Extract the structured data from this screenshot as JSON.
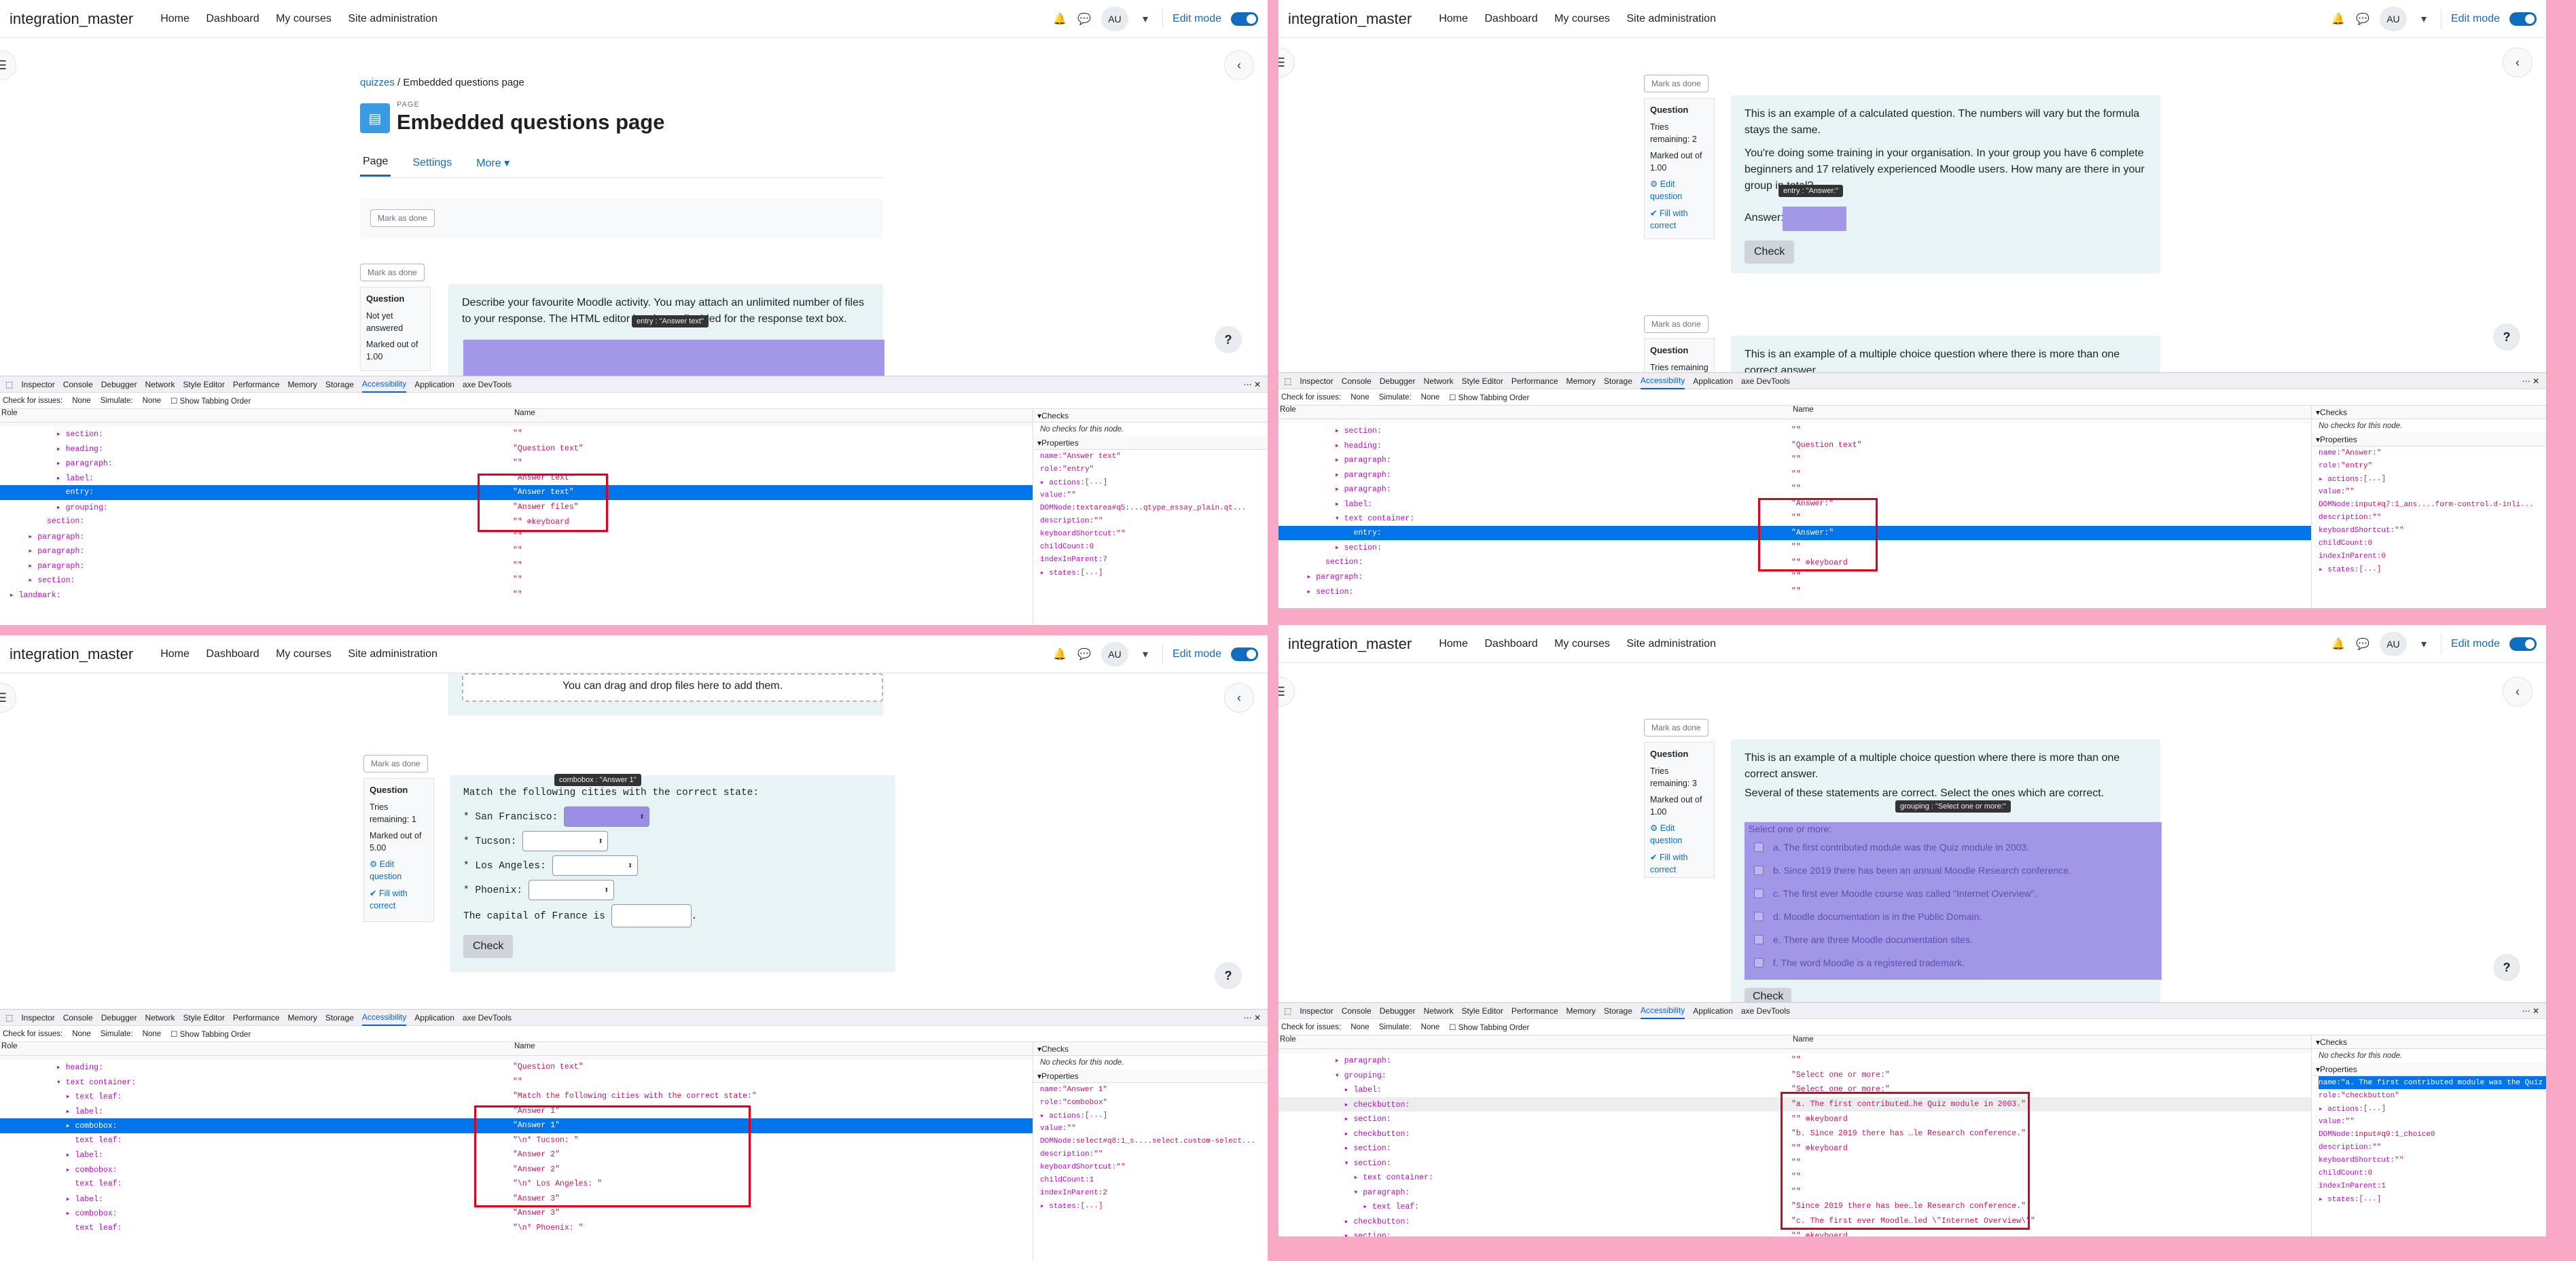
{
  "brand": "integration_master",
  "nav": [
    "Home",
    "Dashboard",
    "My courses",
    "Site administration"
  ],
  "avatar": "AU",
  "edit_mode": "Edit mode",
  "devtools": {
    "tabs": [
      "Inspector",
      "Console",
      "Debugger",
      "Network",
      "Style Editor",
      "Performance",
      "Memory",
      "Storage",
      "Accessibility",
      "Application",
      "axe DevTools"
    ],
    "check_issues": "Check for issues:",
    "check_none": "None",
    "simulate": "Simulate:",
    "simulate_none": "None",
    "tabbing": "Show Tabbing Order",
    "col_role": "Role",
    "col_name": "Name",
    "checks": "Checks",
    "no_checks": "No checks for this node.",
    "properties": "Properties"
  },
  "q0": {
    "crumb_link": "quizzes",
    "crumb_sep": "/",
    "crumb_page": "Embedded questions page",
    "page_label": "PAGE",
    "title": "Embedded questions page",
    "tabs": [
      "Page",
      "Settings",
      "More"
    ],
    "mark_done": "Mark as done",
    "info_title": "Question",
    "info_status": "Not yet answered",
    "info_marked": "Marked out of 1.00",
    "question": "Describe your favourite Moodle activity. You may attach an unlimited number of files to your response. The HTML editor has been disabled for the response text box.",
    "tooltip": "entry : \"Answer text\"",
    "tree": [
      {
        "r": "            ▸ section:",
        "n": "\"\""
      },
      {
        "r": "            ▸ heading:",
        "n": "\"Question text\""
      },
      {
        "r": "            ▸ paragraph:",
        "n": "\"\""
      },
      {
        "r": "            ▸ label:",
        "n": "\"Answer text\""
      },
      {
        "r": "              entry:",
        "n": "\"Answer text\"",
        "sel": true
      },
      {
        "r": "            ▸ grouping:",
        "n": "\"Answer files\""
      },
      {
        "r": "          section:",
        "n": "\"\" ⊕keyboard"
      },
      {
        "r": "      ▸ paragraph:",
        "n": "\"\""
      },
      {
        "r": "      ▸ paragraph:",
        "n": "\"\""
      },
      {
        "r": "      ▸ paragraph:",
        "n": "\"\""
      },
      {
        "r": "      ▸ section:",
        "n": "\"\""
      },
      {
        "r": "  ▸ landmark:",
        "n": "\"\""
      }
    ],
    "props": [
      {
        "k": "name: ",
        "v": "\"Answer text\""
      },
      {
        "k": "role: ",
        "v": "\"entry\""
      },
      {
        "k": "▸ actions: ",
        "v": "[...]"
      },
      {
        "k": "value: ",
        "v": "\"\""
      },
      {
        "k": "DOMNode: ",
        "v": "textarea#q5:...qtype_essay_plain.qt..."
      },
      {
        "k": "description: ",
        "v": "\"\""
      },
      {
        "k": "keyboardShortcut: ",
        "v": "\"\""
      },
      {
        "k": "childCount: ",
        "v": "0"
      },
      {
        "k": "indexInParent: ",
        "v": "7"
      },
      {
        "k": "▸ states: ",
        "v": "[...]"
      }
    ]
  },
  "q1": {
    "mark_done": "Mark as done",
    "info_title": "Question",
    "info_tries": "Tries remaining: 2",
    "info_marked": "Marked out of 1.00",
    "edit": "Edit question",
    "fill": "Fill with correct",
    "p1": "This is an example of a calculated question. The numbers will vary but the formula stays the same.",
    "p2": "You're doing some training in your organisation. In your group you have 6 complete beginners and 17 relatively experienced Moodle users. How many are there in your group in total?",
    "answer": "Answer:",
    "tooltip": "entry : \"Answer:\"",
    "check": "Check",
    "info2_title": "Question",
    "info2_tries": "Tries remaining",
    "p3": "This is an example of a multiple choice question where there is more than one correct answer.",
    "tree": [
      {
        "r": "            ▸ section:",
        "n": "\"\""
      },
      {
        "r": "            ▸ heading:",
        "n": "\"Question text\""
      },
      {
        "r": "            ▸ paragraph:",
        "n": "\"\""
      },
      {
        "r": "            ▸ paragraph:",
        "n": "\"\""
      },
      {
        "r": "            ▸ paragraph:",
        "n": "\"\""
      },
      {
        "r": "            ▸ label:",
        "n": "\"Answer:\""
      },
      {
        "r": "            ▾ text container:",
        "n": "\"\""
      },
      {
        "r": "                entry:",
        "n": "\"Answer:\"",
        "sel": true
      },
      {
        "r": "            ▸ section:",
        "n": "\"\""
      },
      {
        "r": "          section:",
        "n": "\"\" ⊕keyboard"
      },
      {
        "r": "      ▸ paragraph:",
        "n": "\"\""
      },
      {
        "r": "      ▸ section:",
        "n": "\"\""
      }
    ],
    "props": [
      {
        "k": "name: ",
        "v": "\"Answer:\""
      },
      {
        "k": "role: ",
        "v": "\"entry\""
      },
      {
        "k": "▸ actions: ",
        "v": "[...]"
      },
      {
        "k": "value: ",
        "v": "\"\""
      },
      {
        "k": "DOMNode: ",
        "v": "input#q7:1_ans....form-control.d-inli..."
      },
      {
        "k": "description: ",
        "v": "\"\""
      },
      {
        "k": "keyboardShortcut: ",
        "v": "\"\""
      },
      {
        "k": "childCount: ",
        "v": "0"
      },
      {
        "k": "indexInParent: ",
        "v": "0"
      },
      {
        "k": "▸ states: ",
        "v": "[...]"
      }
    ]
  },
  "q2": {
    "dropzone": "You can drag and drop files here to add them.",
    "mark_done": "Mark as done",
    "info_title": "Question",
    "info_tries": "Tries remaining: 1",
    "info_marked": "Marked out of 5.00",
    "edit": "Edit question",
    "fill": "Fill with correct",
    "intro": "Match the following cities with the correct state:",
    "cities": [
      "* San Francisco:",
      "* Tucson:",
      "* Los Angeles:",
      "* Phoenix:"
    ],
    "capital": "The capital of France is",
    "tooltip": "combobox : \"Answer 1\"",
    "check": "Check",
    "tree": [
      {
        "r": "            ▸ heading:",
        "n": "\"Question text\""
      },
      {
        "r": "            ▾ text container:",
        "n": "\"\""
      },
      {
        "r": "              ▸ text leaf:",
        "n": "\"Match the following cities with the correct state:\""
      },
      {
        "r": "              ▸ label:",
        "n": "\"Answer 1\""
      },
      {
        "r": "              ▸ combobox:",
        "n": "\"Answer 1\"",
        "sel": true
      },
      {
        "r": "                text leaf:",
        "n": "\"\\n* Tucson: \""
      },
      {
        "r": "              ▸ label:",
        "n": "\"Answer 2\""
      },
      {
        "r": "              ▸ combobox:",
        "n": "\"Answer 2\""
      },
      {
        "r": "                text leaf:",
        "n": "\"\\n* Los Angeles: \""
      },
      {
        "r": "              ▸ label:",
        "n": "\"Answer 3\""
      },
      {
        "r": "              ▸ combobox:",
        "n": "\"Answer 3\""
      },
      {
        "r": "                text leaf:",
        "n": "\"\\n* Phoenix: \""
      }
    ],
    "props": [
      {
        "k": "name: ",
        "v": "\"Answer 1\""
      },
      {
        "k": "role: ",
        "v": "\"combobox\""
      },
      {
        "k": "▸ actions: ",
        "v": "[...]"
      },
      {
        "k": "value: ",
        "v": "\"\""
      },
      {
        "k": "DOMNode: ",
        "v": "select#q8:1_s....select.custom-select..."
      },
      {
        "k": "description: ",
        "v": "\"\""
      },
      {
        "k": "keyboardShortcut: ",
        "v": "\"\""
      },
      {
        "k": "childCount: ",
        "v": "1"
      },
      {
        "k": "indexInParent: ",
        "v": "2"
      },
      {
        "k": "▸ states: ",
        "v": "[...]"
      }
    ]
  },
  "q3": {
    "mark_done": "Mark as done",
    "info_title": "Question",
    "info_tries": "Tries remaining: 3",
    "info_marked": "Marked out of 1.00",
    "edit": "Edit question",
    "fill": "Fill with correct",
    "p1": "This is an example of a multiple choice question where there is more than one correct answer.",
    "p2": "Several of these statements are correct. Select the ones which are correct.",
    "tooltip": "grouping : \"Select one or more:\"",
    "select_prompt": "Select one or more:",
    "options": [
      "a.  The first contributed module was the Quiz module in 2003.",
      "b.  Since 2019 there has been an annual Moodle Research conference.",
      "c.  The first ever Moodle course was called \"Internet Overview\".",
      "d.  Moodle documentation is in the Public Domain.",
      "e.  There are three Moodle documentation sites.",
      "f.  The word Moodle is a registered trademark."
    ],
    "check": "Check",
    "tree": [
      {
        "r": "            ▸ paragraph:",
        "n": "\"\""
      },
      {
        "r": "            ▾ grouping:",
        "n": "\"Select one or more:\""
      },
      {
        "r": "              ▸ label:",
        "n": "\"Select one or more:\""
      },
      {
        "r": "              ▸ checkbutton:",
        "n": "\"a. The first contributed…he Quiz module in 2003.\"",
        "alt": true
      },
      {
        "r": "              ▸ section:",
        "n": "\"\" ⊕keyboard"
      },
      {
        "r": "              ▸ checkbutton:",
        "n": "\"b. Since 2019 there has …le Research conference.\""
      },
      {
        "r": "              ▸ section:",
        "n": "\"\" ⊕keyboard"
      },
      {
        "r": "              ▾ section:",
        "n": "\"\""
      },
      {
        "r": "                ▸ text container:",
        "n": "\"\""
      },
      {
        "r": "                ▾ paragraph:",
        "n": "\"\""
      },
      {
        "r": "                  ▸ text leaf:",
        "n": "\"Since 2019 there has bee…le Research conference.\""
      },
      {
        "r": "              ▸ checkbutton:",
        "n": "\"c. The first ever Moodle…led \\\"Internet Overview\\\"\""
      },
      {
        "r": "              ▸ section:",
        "n": "\"\" ⊕keyboard"
      }
    ],
    "props": [
      {
        "k": "name: ",
        "v": "\"a. The first contributed module was the Quiz m...\"",
        "sel": true
      },
      {
        "k": "role: ",
        "v": "\"checkbutton\""
      },
      {
        "k": "▸ actions: ",
        "v": "[...]"
      },
      {
        "k": "value: ",
        "v": "\"\""
      },
      {
        "k": "DOMNode: ",
        "v": "input#q9:1_choice0"
      },
      {
        "k": "description: ",
        "v": "\"\""
      },
      {
        "k": "keyboardShortcut: ",
        "v": "\"\""
      },
      {
        "k": "childCount: ",
        "v": "0"
      },
      {
        "k": "indexInParent: ",
        "v": "1"
      },
      {
        "k": "▸ states: ",
        "v": "[...]"
      }
    ]
  }
}
